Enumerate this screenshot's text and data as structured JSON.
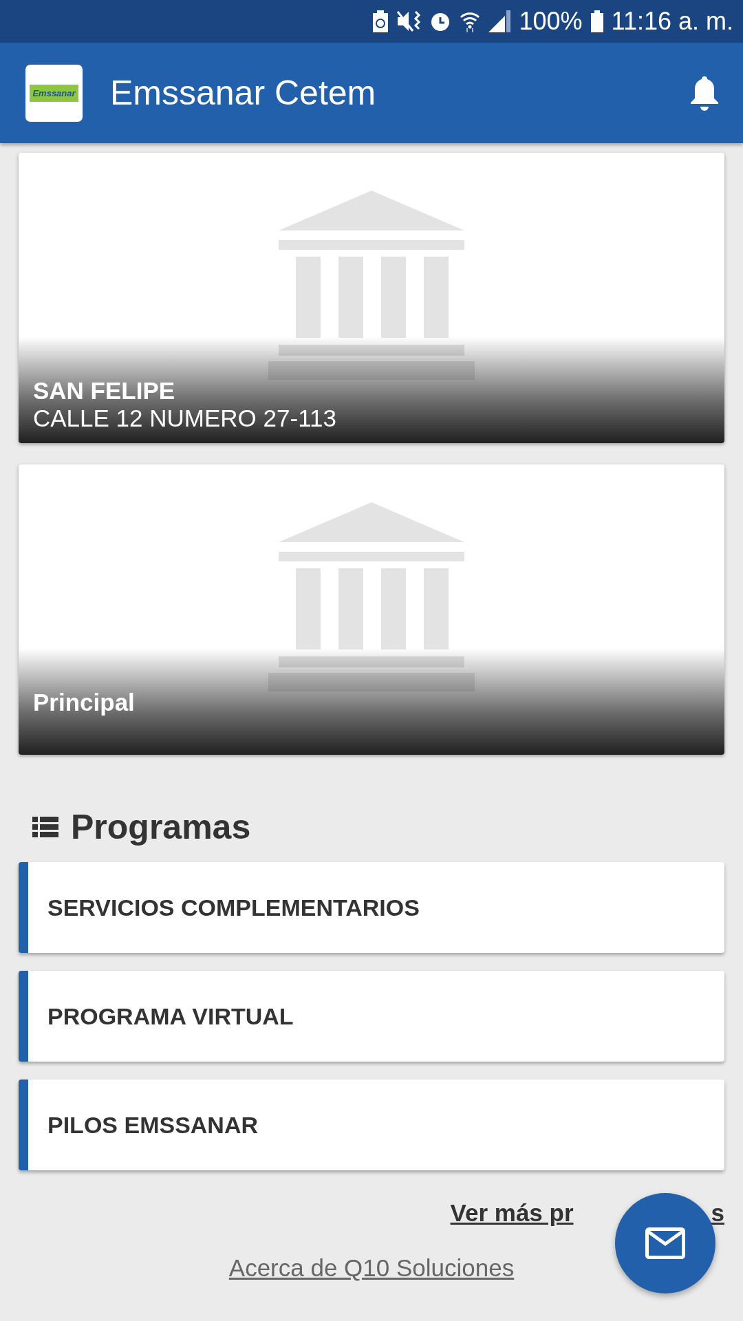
{
  "status_bar": {
    "battery_percent": "100%",
    "time": "11:16 a. m."
  },
  "app_bar": {
    "logo_text": "Emssanar",
    "title": "Emssanar Cetem"
  },
  "branches": [
    {
      "name": "SAN FELIPE",
      "address": "CALLE 12 NUMERO 27-113"
    },
    {
      "name": "Principal"
    }
  ],
  "programs": {
    "heading": "Programas",
    "items": [
      {
        "label": "SERVICIOS COMPLEMENTARIOS"
      },
      {
        "label": "PROGRAMA VIRTUAL"
      },
      {
        "label": "PILOS EMSSANAR"
      }
    ],
    "more_link": {
      "start": "Ver más pr",
      "end": "s"
    }
  },
  "footer": {
    "link": "Acerca de Q10 Soluciones"
  }
}
